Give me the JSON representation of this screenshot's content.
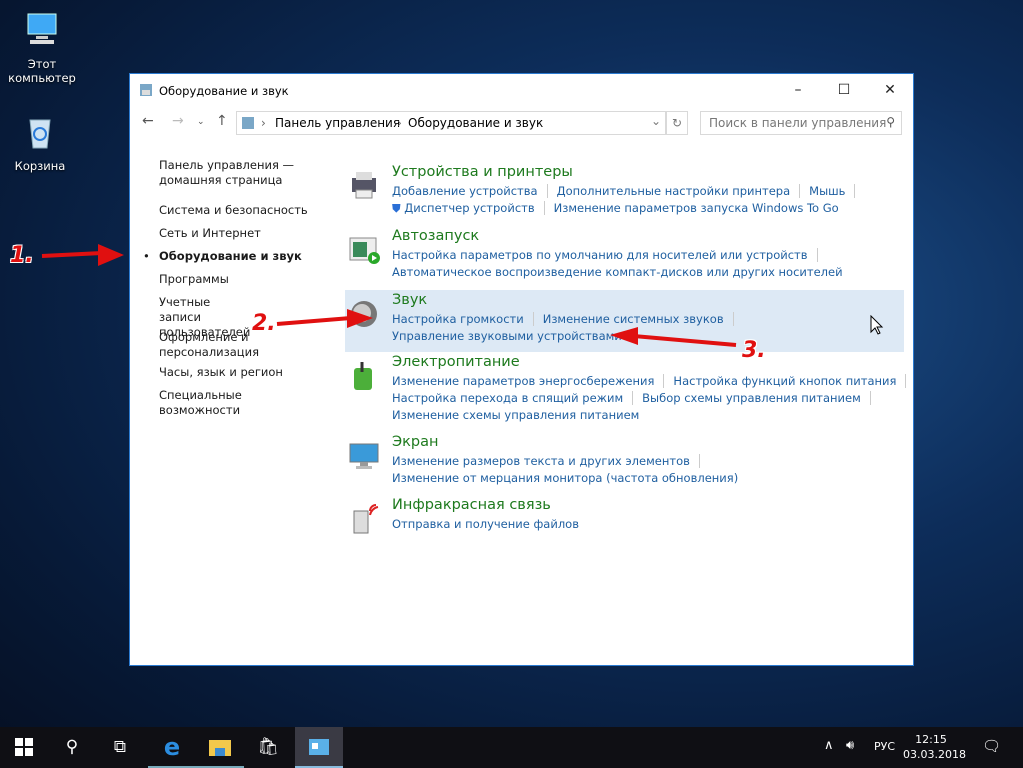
{
  "desktop": {
    "icons": [
      {
        "label": "Этот компьютер",
        "icon": "computer-icon"
      },
      {
        "label": "Корзина",
        "icon": "recycle-bin-icon"
      }
    ]
  },
  "window": {
    "title": "Оборудование и звук",
    "minimize": "–",
    "maximize": "☐",
    "close": "✕"
  },
  "address": {
    "breadcrumb": [
      "Панель управления",
      "Оборудование и звук"
    ],
    "search_placeholder": "Поиск в панели управления"
  },
  "left_nav": [
    {
      "label": "Панель управления — домашняя страница"
    },
    {
      "label": "Система и безопасность"
    },
    {
      "label": "Сеть и Интернет"
    },
    {
      "label": "Оборудование и звук",
      "active": true
    },
    {
      "label": "Программы"
    },
    {
      "label": "Учетные записи пользователей"
    },
    {
      "label": "Оформление и персонализация"
    },
    {
      "label": "Часы, язык и регион"
    },
    {
      "label": "Специальные возможности"
    }
  ],
  "categories": [
    {
      "title": "Устройства и принтеры",
      "rows": [
        [
          "Добавление устройства",
          "Дополнительные настройки принтера",
          "Мышь"
        ],
        [
          "Диспетчер устройств",
          "Изменение параметров запуска Windows To Go"
        ]
      ]
    },
    {
      "title": "Автозапуск",
      "rows": [
        [
          "Настройка параметров по умолчанию для носителей или устройств"
        ],
        [
          "Автоматическое воспроизведение компакт-дисков или других носителей"
        ]
      ]
    },
    {
      "title": "Звук",
      "rows": [
        [
          "Настройка громкости",
          "Изменение системных звуков"
        ],
        [
          "Управление звуковыми устройствами"
        ]
      ]
    },
    {
      "title": "Электропитание",
      "rows": [
        [
          "Изменение параметров энергосбережения",
          "Настройка функций кнопок питания"
        ],
        [
          "Настройка перехода в спящий режим",
          "Выбор схемы управления питанием"
        ],
        [
          "Изменение схемы управления питанием"
        ]
      ]
    },
    {
      "title": "Экран",
      "rows": [
        [
          "Изменение размеров текста и других элементов"
        ],
        [
          "Изменение от мерцания монитора (частота обновления)"
        ]
      ]
    },
    {
      "title": "Инфракрасная связь",
      "rows": [
        [
          "Отправка и получение файлов"
        ]
      ]
    }
  ],
  "annotations": [
    "1.",
    "2.",
    "3."
  ],
  "taskbar": {
    "lang": "РУС",
    "time": "12:15",
    "date": "03.03.2018"
  },
  "colors": {
    "accent": "#2b7bd1",
    "category_title": "#1e7a1e",
    "link": "#1f5fa0",
    "highlight": "#dde9f5",
    "annotation": "#e01010"
  }
}
